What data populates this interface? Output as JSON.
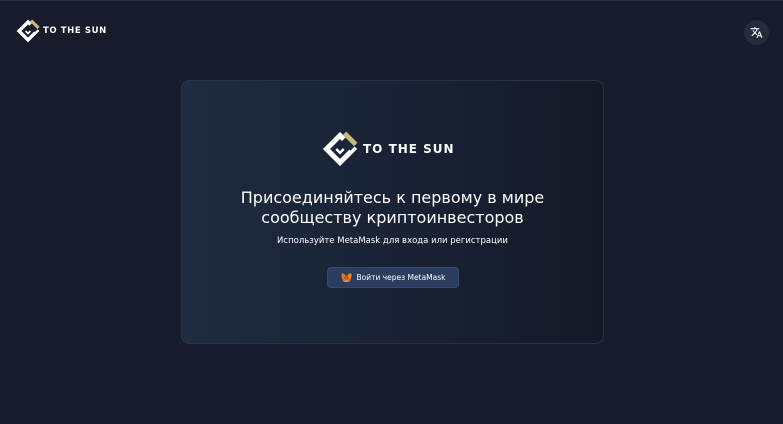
{
  "header": {
    "logo_text": "TO THE SUN",
    "language_icon": "translate-icon"
  },
  "card": {
    "logo_text": "TO THE SUN",
    "title_line1": "Присоединяйтесь к первому в мире",
    "title_line2": "сообществу криптоинвесторов",
    "subtitle": "Используйте MetaMask для входа или регистрации",
    "login_button_label": "Войти через MetaMask",
    "login_button_icon": "metamask-fox-icon"
  },
  "colors": {
    "background": "#171b2b",
    "card_gradient_start": "#1e2b40",
    "card_gradient_end": "#141927",
    "button_background": "#2b3c5e",
    "logo_gold": "#c8b77a",
    "logo_white": "#ffffff"
  }
}
